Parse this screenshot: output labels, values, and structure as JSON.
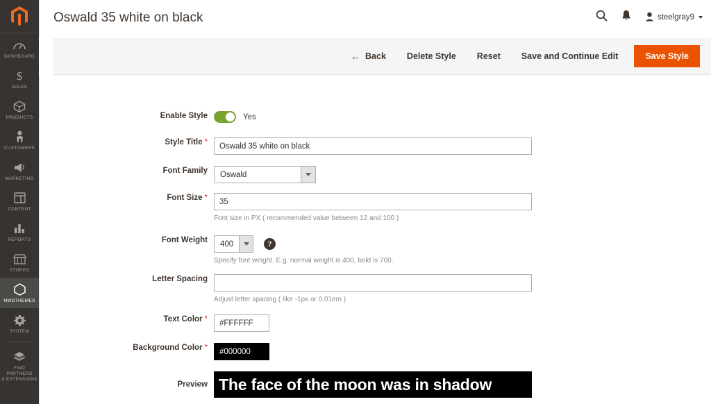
{
  "sidebar": {
    "logo": "magento-logo",
    "items": [
      {
        "label": "Dashboard",
        "icon": "dashboard-icon",
        "active": false
      },
      {
        "label": "Sales",
        "icon": "dollar-icon",
        "active": false
      },
      {
        "label": "Products",
        "icon": "box-icon",
        "active": false
      },
      {
        "label": "Customers",
        "icon": "person-icon",
        "active": false
      },
      {
        "label": "Marketing",
        "icon": "megaphone-icon",
        "active": false
      },
      {
        "label": "Content",
        "icon": "layout-icon",
        "active": false
      },
      {
        "label": "Reports",
        "icon": "bar-chart-icon",
        "active": false
      },
      {
        "label": "Stores",
        "icon": "storefront-icon",
        "active": false
      },
      {
        "label": "NWDTHEMES",
        "icon": "hexagon-icon",
        "active": true
      },
      {
        "label": "System",
        "icon": "gear-icon",
        "active": false
      },
      {
        "label": "Find Partners\n& Extensions",
        "icon": "extension-icon",
        "active": false
      }
    ]
  },
  "header": {
    "title": "Oswald 35 white on black",
    "search_icon": "search-icon",
    "notification_icon": "bell-icon",
    "user_icon": "user-avatar-icon",
    "user_name": "steelgray9"
  },
  "action_bar": {
    "back": "Back",
    "back_arrow": "←",
    "delete": "Delete Style",
    "reset": "Reset",
    "save_continue": "Save and Continue Edit",
    "save": "Save Style"
  },
  "form": {
    "enable_style": {
      "label": "Enable Style",
      "value": "Yes",
      "toggle_on": true,
      "toggle_color": "#79a22e"
    },
    "style_title": {
      "label": "Style Title",
      "required": "*",
      "value": "Oswald 35 white on black"
    },
    "font_family": {
      "label": "Font Family",
      "value": "Oswald"
    },
    "font_size": {
      "label": "Font Size",
      "required": "*",
      "value": "35",
      "note": "Font size in PX ( recommended value between 12 and 100 )"
    },
    "font_weight": {
      "label": "Font Weight",
      "value": "400",
      "help_icon": "question-mark-icon",
      "help_glyph": "?",
      "note": "Specify font weight. E.g. normal weight is 400, bold is 700."
    },
    "letter_spacing": {
      "label": "Letter Spacing",
      "value": "",
      "note": "Adjust letter spacing ( like -1px or 0.01em )"
    },
    "text_color": {
      "label": "Text Color",
      "required": "*",
      "value": "#FFFFFF"
    },
    "background_color": {
      "label": "Background Color",
      "required": "*",
      "value": "#000000"
    },
    "preview": {
      "label": "Preview",
      "text": "The face of the moon was in shadow",
      "text_color": "#FFFFFF",
      "background_color": "#000000"
    }
  },
  "colors": {
    "brand_orange": "#eb5202",
    "sidebar_bg": "#373330",
    "active_bg": "#4a4a47",
    "required_red": "#e02b27"
  }
}
